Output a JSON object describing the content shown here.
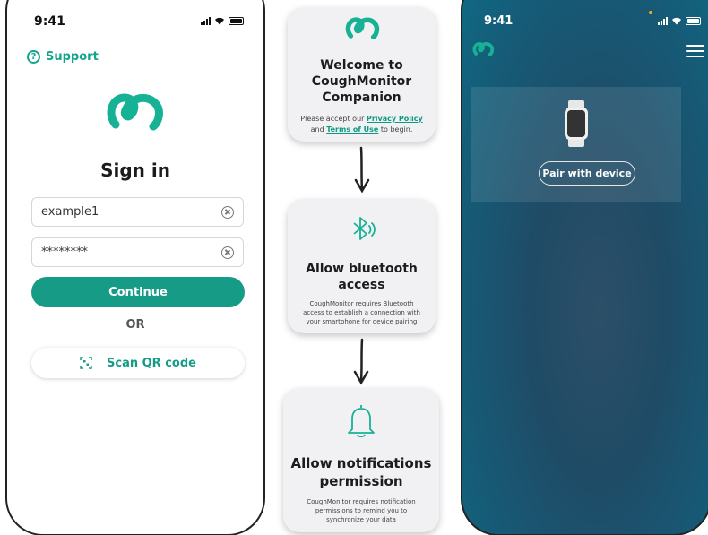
{
  "signin_screen": {
    "status_time": "9:41",
    "support_label": "Support",
    "title": "Sign in",
    "username_value": "example1",
    "password_value": "********",
    "continue_label": "Continue",
    "or_label": "OR",
    "scan_qr_label": "Scan QR code"
  },
  "onboarding": {
    "welcome": {
      "title_line1": "Welcome to",
      "title_line2": "CoughMonitor",
      "title_line3": "Companion",
      "text_before": "Please accept our ",
      "privacy_link": "Privacy Policy",
      "text_and": "and ",
      "terms_link": "Terms of Use",
      "text_after": " to begin."
    },
    "bluetooth": {
      "title_line1": "Allow bluetooth",
      "title_line2": "access",
      "desc_line1": "CoughMonitor requires Bluetooth",
      "desc_line2": "access to establish a connection with",
      "desc_line3": "your smartphone for device pairing"
    },
    "notifications": {
      "title_line1": "Allow notifications",
      "title_line2": "permission",
      "desc_line1": "CoughMonitor requires notification",
      "desc_line2": "permissions to remind you to",
      "desc_line3": "synchronize your data"
    }
  },
  "dashboard_screen": {
    "status_time": "9:41",
    "pair_label": "Pair with device"
  },
  "colors": {
    "accent": "#13a58c",
    "dashboard_bg": "#1f4b66"
  },
  "icons": [
    "logo-icon",
    "support-icon",
    "clear-icon",
    "qr-code-icon",
    "bluetooth-icon",
    "bell-icon",
    "watch-icon",
    "menu-icon",
    "arrow-down-icon"
  ]
}
